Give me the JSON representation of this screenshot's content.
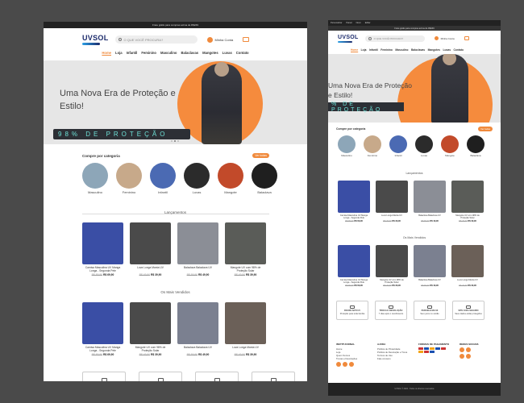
{
  "top_bar": "Frete grátis para compras acima de R$249",
  "logo": "UVSOL",
  "search_placeholder": "O QUE VOCÊ PROCURA?",
  "account_label": "Minha Conta",
  "nav": [
    {
      "label": "Home",
      "active": true
    },
    {
      "label": "Loja"
    },
    {
      "label": "Infantil"
    },
    {
      "label": "Feminino"
    },
    {
      "label": "Masculino"
    },
    {
      "label": "Balaclavas"
    },
    {
      "label": "Mangotes"
    },
    {
      "label": "Luvas"
    },
    {
      "label": "Contato"
    }
  ],
  "hero": {
    "title": "Uma Nova Era de Proteção e Estilo!",
    "protection": "98% DE PROTEÇÃO",
    "protection_mobile": "% DE PROTEÇÃO"
  },
  "categories_section": {
    "title": "Compre por categoria",
    "see_all": "Ver todas",
    "items": [
      {
        "label": "Masculino",
        "color": "#8da6b8"
      },
      {
        "label": "Feminino",
        "color": "#c7a98a"
      },
      {
        "label": "Infantil",
        "color": "#4b6ab3"
      },
      {
        "label": "Luvas",
        "color": "#2b2b2b"
      },
      {
        "label": "Mangote",
        "color": "#c24a2a"
      },
      {
        "label": "Balaclava",
        "color": "#1f1f1f"
      }
    ]
  },
  "launches": {
    "title": "Lançamentos",
    "products": [
      {
        "name": "Camisa Masculina UV Manga Longa - Segunda Pele",
        "old": "R$ 89,90",
        "price": "R$ 69,90",
        "color": "#3a4ea5"
      },
      {
        "name": "Luva Longa Manta UV",
        "old": "R$ 49,90",
        "price": "R$ 39,90",
        "color": "#4a4a4a"
      },
      {
        "name": "Balaclava Balaclava UV",
        "old": "R$ 59,90",
        "price": "R$ 49,90",
        "color": "#8b8e96"
      },
      {
        "name": "Mangote UV com 98% de Proteção Solar",
        "old": "R$ 49,90",
        "price": "R$ 39,90",
        "color": "#5a5c58"
      }
    ]
  },
  "best_sellers": {
    "title": "Os Mais Vendidos",
    "products": [
      {
        "name": "Camisa Masculina UV Manga Longa - Segunda Pele",
        "old": "R$ 89,90",
        "price": "R$ 69,90",
        "color": "#3a4ea5"
      },
      {
        "name": "Mangote UV com 98% de Proteção Solar",
        "old": "R$ 49,90",
        "price": "R$ 39,90",
        "color": "#4a4a4a"
      },
      {
        "name": "Balaclava Balaclava UV",
        "old": "R$ 59,90",
        "price": "R$ 49,90",
        "color": "#7b8090"
      },
      {
        "name": "Luva Longa Manta UV",
        "old": "R$ 49,90",
        "price": "R$ 39,90",
        "color": "#6b6058"
      }
    ]
  },
  "features": [
    {
      "title": "ROUPA ANTI UV",
      "sub": "Proteção para toda família"
    },
    {
      "title": "TROCA E DEVOLUÇÃO",
      "sub": "7 dias após o recebimento"
    },
    {
      "title": "PARCELE EM 3X",
      "sub": "Sem juros no cartão"
    },
    {
      "title": "SITE 100% SEGURO",
      "sub": "Seus dados estão protegidos"
    }
  ],
  "footer": {
    "institutional": {
      "title": "INSTITUCIONAL",
      "links": [
        "Home",
        "Loja",
        "Quem Somos",
        "Trocas e Devoluções",
        "Contato"
      ]
    },
    "help": {
      "title": "AJUDA",
      "links": [
        "Política de Privacidade",
        "Política de Devolução e Troca",
        "Termos de Uso",
        "Fale conosco"
      ]
    },
    "payment": {
      "title": "FORMAS DE PAGAMENTO"
    },
    "social": {
      "title": "REDES SOCIAIS"
    },
    "copyright": "UVSOL © 2024 - Todos os direitos reservados"
  },
  "admin_bar": [
    "Personalizar",
    "Painel",
    "Novo",
    "Editar"
  ]
}
